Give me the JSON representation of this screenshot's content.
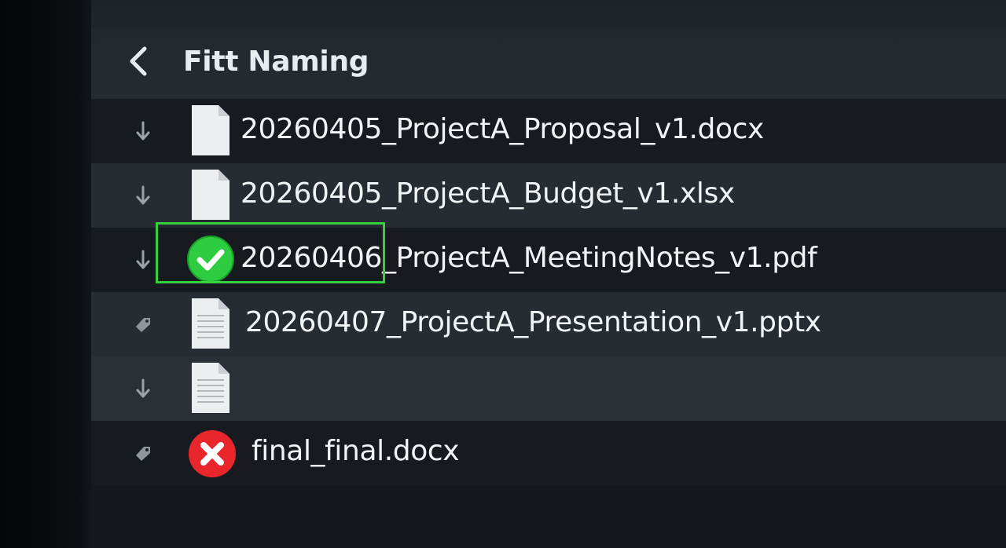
{
  "header": {
    "back_icon": "chevron-left-icon",
    "title": "Fitt Naming"
  },
  "files": [
    {
      "gutter_icon": "down-arrow-icon",
      "type_icon": "document-icon",
      "name": "20260405_ProjectA_Proposal_v1.docx"
    },
    {
      "gutter_icon": "down-arrow-icon",
      "type_icon": "document-icon",
      "name": "20260405_ProjectA_Budget_v1.xlsx"
    },
    {
      "gutter_icon": "down-arrow-icon",
      "type_icon": "check-circle-icon",
      "name": "20260406_ProjectA_MeetingNotes_v1.pdf",
      "highlighted": true
    },
    {
      "gutter_icon": "tag-icon",
      "type_icon": "lined-document-icon",
      "name": "20260407_ProjectA_Presentation_v1.pptx"
    },
    {
      "gutter_icon": "down-arrow-icon",
      "type_icon": "lined-document-icon",
      "name": ""
    },
    {
      "gutter_icon": "tag-icon",
      "type_icon": "x-circle-icon",
      "name": "final_final.docx"
    }
  ],
  "colors": {
    "success": "#2ecc40",
    "error": "#e8262b",
    "highlight": "#35d13c"
  }
}
